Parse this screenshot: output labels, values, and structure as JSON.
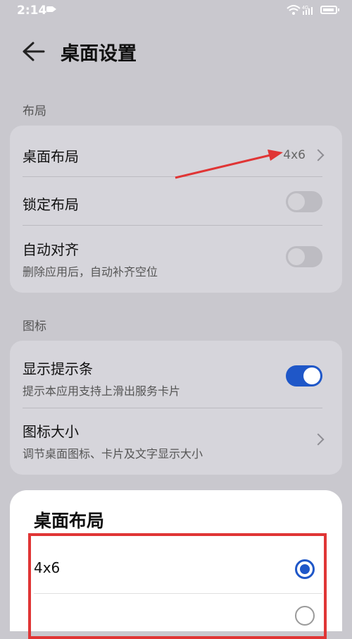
{
  "status_bar": {
    "time": "2:14",
    "signal_text": "4G"
  },
  "header": {
    "title": "桌面设置"
  },
  "sections": {
    "layout": {
      "label": "布局",
      "desktop_layout": {
        "label": "桌面布局",
        "value": "4x6"
      },
      "lock_layout": {
        "label": "锁定布局",
        "enabled": false
      },
      "auto_align": {
        "label": "自动对齐",
        "sub": "删除应用后，自动补齐空位",
        "enabled": false
      }
    },
    "icons": {
      "label": "图标",
      "show_hint_bar": {
        "label": "显示提示条",
        "sub": "提示本应用支持上滑出服务卡片",
        "enabled": true
      },
      "icon_size": {
        "label": "图标大小",
        "sub": "调节桌面图标、卡片及文字显示大小"
      }
    }
  },
  "sheet": {
    "title": "桌面布局",
    "options": [
      {
        "label": "4x6",
        "selected": true
      },
      {
        "label": "",
        "selected": false
      }
    ]
  },
  "colors": {
    "accent": "#1f57c8",
    "annotation": "#e03535",
    "background": "#c9c8ce"
  }
}
